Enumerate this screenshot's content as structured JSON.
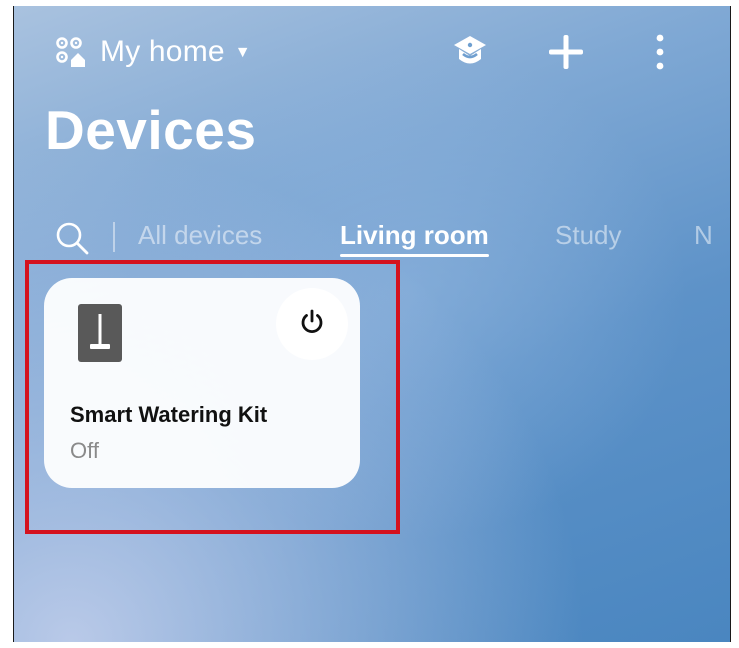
{
  "header": {
    "home_name": "My home",
    "home_icon": "home-qr-icon",
    "caret": "▼",
    "actions": [
      {
        "name": "scene-icon"
      },
      {
        "name": "plus-icon"
      },
      {
        "name": "more-vertical-icon"
      }
    ]
  },
  "page": {
    "title": "Devices"
  },
  "tabs": {
    "items": [
      {
        "label": "All devices",
        "active": false
      },
      {
        "label": "Living room",
        "active": true
      },
      {
        "label": "Study",
        "active": false
      },
      {
        "label": "N",
        "active": false
      }
    ]
  },
  "device": {
    "name": "Smart Watering Kit",
    "status": "Off",
    "icon": "watering-kit-icon",
    "power_icon": "power-icon"
  },
  "colors": {
    "highlight": "#d4121e",
    "icon_tile": "#595959",
    "text_dark": "#111111",
    "text_muted": "#8a8a8a"
  }
}
